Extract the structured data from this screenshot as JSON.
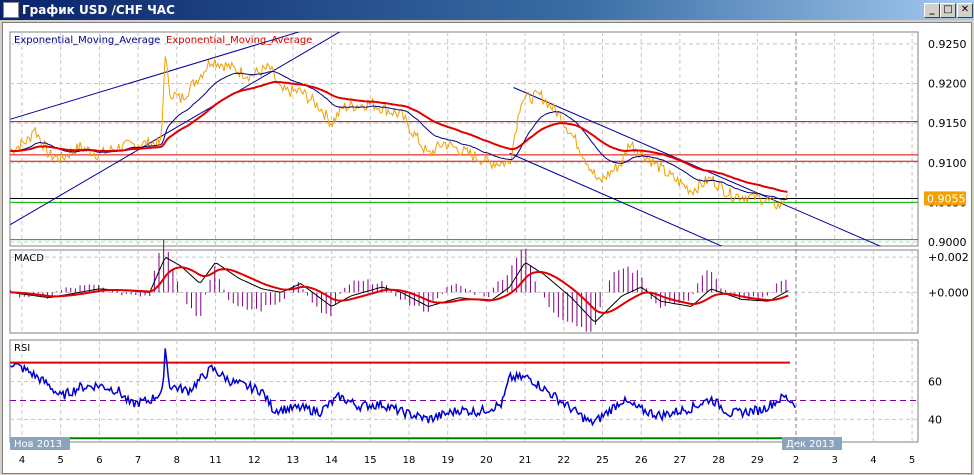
{
  "window": {
    "title": "График USD /CHF  ЧАС",
    "minimize": "_",
    "restore": "□",
    "close": "✕"
  },
  "chart_data": [
    {
      "type": "line",
      "title": "Exponential_Moving_Average",
      "legend": [
        "Exponential_Moving_Average",
        "Exponential_Moving_Average"
      ],
      "ylim": [
        0.8995,
        0.9265
      ],
      "yticks": [
        "0.9250",
        "0.9200",
        "0.9150",
        "0.9100",
        "0.9050",
        "0.9000"
      ],
      "last_price": "0.9055",
      "price": {
        "x": [
          -0.3,
          0.2,
          0.3,
          0.7,
          1.0,
          1.5,
          2.0,
          2.5,
          3.3,
          3.6,
          3.7,
          3.8,
          4.1,
          4.6,
          4.9,
          5.4,
          5.9,
          6.4,
          6.7,
          7.2,
          7.7,
          8.0,
          8.3,
          9.0,
          9.8,
          10.5,
          10.9,
          11.6,
          12.1,
          12.6,
          12.9,
          13.4,
          13.9,
          14.4,
          14.9,
          15.5,
          15.7,
          16.2,
          16.7,
          17.3,
          17.8,
          18.3,
          19.1,
          19.6,
          19.8
        ],
        "y": [
          0.9115,
          0.913,
          0.9145,
          0.911,
          0.9105,
          0.912,
          0.911,
          0.912,
          0.9125,
          0.9125,
          0.924,
          0.919,
          0.918,
          0.921,
          0.923,
          0.922,
          0.921,
          0.922,
          0.919,
          0.919,
          0.917,
          0.915,
          0.917,
          0.9175,
          0.916,
          0.911,
          0.9125,
          0.911,
          0.91,
          0.91,
          0.918,
          0.9185,
          0.916,
          0.912,
          0.9075,
          0.91,
          0.9125,
          0.9105,
          0.9085,
          0.9065,
          0.908,
          0.906,
          0.9055,
          0.9045,
          0.9065
        ]
      },
      "levels": [
        {
          "value": 0.9152,
          "color": "#e00000"
        },
        {
          "value": 0.911,
          "color": "#e00000"
        },
        {
          "value": 0.9102,
          "color": "#e00000"
        },
        {
          "value": 0.9055,
          "color": "#000000"
        },
        {
          "value": 0.905,
          "color": "#00b000"
        },
        {
          "value": 0.9003,
          "color": "#00b000"
        }
      ],
      "trendlines": [
        {
          "x": [
            -0.3,
            8.3
          ],
          "y": [
            0.9155,
            0.9282
          ]
        },
        {
          "x": [
            -0.3,
            8.8
          ],
          "y": [
            0.9022,
            0.9282
          ]
        },
        {
          "x": [
            12.7,
            22.5
          ],
          "y": [
            0.9195,
            0.8988
          ]
        },
        {
          "x": [
            12.6,
            18.4
          ],
          "y": [
            0.9112,
            0.8988
          ]
        }
      ]
    },
    {
      "type": "line",
      "title": "MACD",
      "ylim": [
        -0.0023,
        0.0024
      ],
      "yticks": [
        "+0.002",
        "+0.000"
      ],
      "x": [
        -0.3,
        0.7,
        2.0,
        3.3,
        3.7,
        4.1,
        4.6,
        5.0,
        5.6,
        6.2,
        6.7,
        7.2,
        8.0,
        8.5,
        9.3,
        9.8,
        10.5,
        11.3,
        12.1,
        12.6,
        13.0,
        13.5,
        14.2,
        14.8,
        15.5,
        16.0,
        16.5,
        17.3,
        17.8,
        18.6,
        19.3,
        19.8
      ],
      "y": [
        0,
        -0.0003,
        0.0002,
        0,
        0.002,
        0.0015,
        0.0005,
        0.0017,
        0.0008,
        0.0002,
        0,
        0.0005,
        -0.0008,
        -0.0002,
        0.0003,
        0,
        -0.0008,
        -0.0003,
        -0.0005,
        0.0003,
        0.0017,
        0.001,
        -0.0003,
        -0.0017,
        -0.0002,
        0.0003,
        -0.0005,
        -0.0008,
        0.0002,
        -0.0004,
        -0.0005,
        0.0001
      ]
    },
    {
      "type": "line",
      "title": "RSI",
      "ylim": [
        28,
        82
      ],
      "yticks": [
        "60",
        "40"
      ],
      "levels": [
        70,
        50,
        30
      ],
      "x": [
        -0.3,
        0.2,
        0.7,
        1.0,
        1.5,
        2.0,
        2.5,
        2.8,
        3.3,
        3.65,
        3.7,
        3.8,
        4.3,
        4.9,
        5.4,
        6.2,
        6.5,
        7.2,
        7.7,
        8.2,
        8.7,
        9.3,
        9.8,
        10.5,
        11.3,
        11.8,
        12.4,
        12.6,
        13.1,
        13.9,
        14.7,
        14.9,
        15.5,
        16.0,
        16.5,
        17.3,
        17.8,
        18.3,
        19.1,
        19.7,
        20.0
      ],
      "y": [
        70,
        65,
        58,
        52,
        57,
        58,
        55,
        48,
        50,
        55,
        80,
        58,
        55,
        67,
        60,
        55,
        45,
        46,
        44,
        52,
        47,
        48,
        44,
        40,
        45,
        44,
        48,
        62,
        62,
        50,
        38,
        40,
        50,
        45,
        42,
        46,
        51,
        43,
        45,
        52,
        48
      ]
    },
    {
      "type": "axis",
      "xticks": [
        "4",
        "5",
        "6",
        "7",
        "8",
        "11",
        "12",
        "13",
        "14",
        "15",
        "18",
        "19",
        "20",
        "21",
        "22",
        "25",
        "26",
        "27",
        "28",
        "29",
        "2",
        "3",
        "4",
        "5"
      ],
      "months": [
        "Нов 2013",
        "Дек 2013"
      ]
    }
  ]
}
